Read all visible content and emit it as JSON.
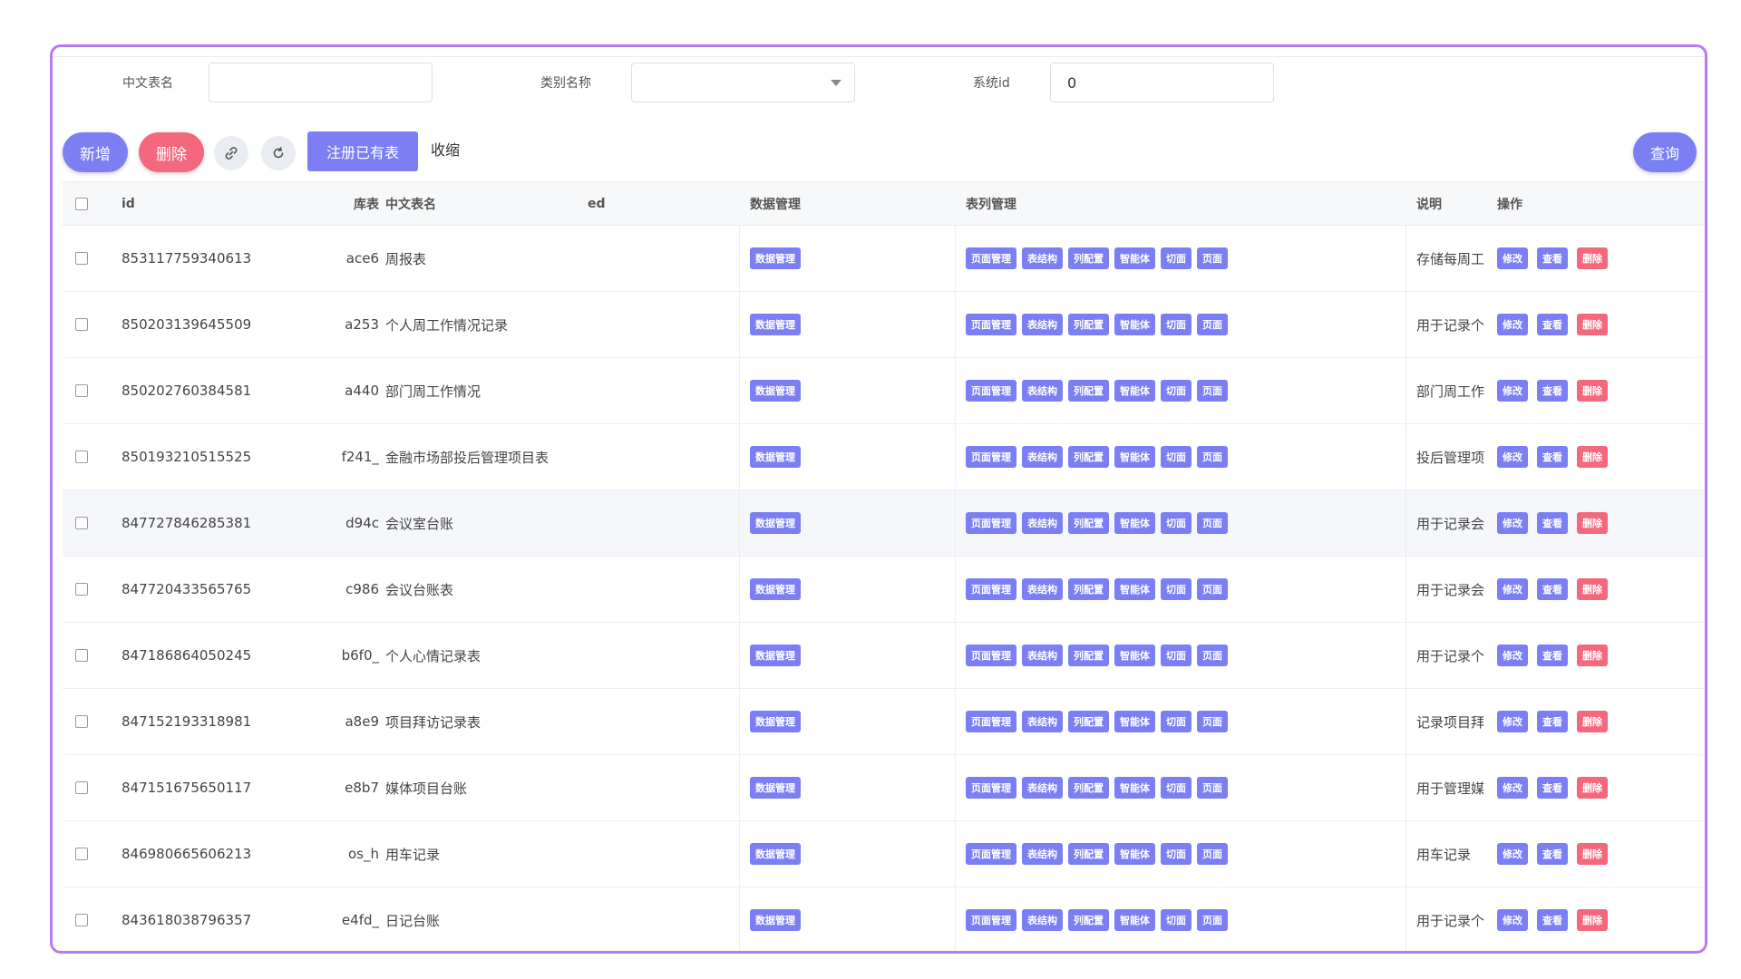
{
  "search": {
    "table_name_label": "中文表名",
    "table_name_value": "",
    "category_label": "类别名称",
    "category_value": "",
    "system_id_label": "系统id",
    "system_id_value": "0"
  },
  "toolbar": {
    "add_label": "新增",
    "delete_label": "删除",
    "link_icon": "link-icon",
    "refresh_icon": "refresh-icon",
    "register_label": "注册已有表",
    "collapse_label": "收缩",
    "query_label": "查询"
  },
  "table": {
    "headers": {
      "id": "id",
      "db_table": "库表",
      "cn_name": "中文表名",
      "extra": "ed",
      "data_mgmt": "数据管理",
      "col_mgmt": "表列管理",
      "desc": "说明",
      "ops": "操作"
    },
    "data_btn": "数据管理",
    "col_btns": [
      "页面管理",
      "表结构",
      "列配置",
      "智能体",
      "切面",
      "页面"
    ],
    "op_btns": [
      "修改",
      "查看",
      "删除"
    ],
    "rows": [
      {
        "id": "853117759340613",
        "db": "ace6",
        "name": "周报表",
        "desc": "存储每周工"
      },
      {
        "id": "850203139645509",
        "db": "a253",
        "name": "个人周工作情况记录",
        "desc": "用于记录个"
      },
      {
        "id": "850202760384581",
        "db": "a440",
        "name": "部门周工作情况",
        "desc": "部门周工作"
      },
      {
        "id": "850193210515525",
        "db": "f241_",
        "name": "金融市场部投后管理项目表",
        "desc": "投后管理项"
      },
      {
        "id": "847727846285381",
        "db": "d94c",
        "name": "会议室台账",
        "desc": "用于记录会"
      },
      {
        "id": "847720433565765",
        "db": "c986",
        "name": "会议台账表",
        "desc": "用于记录会"
      },
      {
        "id": "847186864050245",
        "db": "b6f0_",
        "name": "个人心情记录表",
        "desc": "用于记录个"
      },
      {
        "id": "847152193318981",
        "db": "a8e9",
        "name": "项目拜访记录表",
        "desc": "记录项目拜"
      },
      {
        "id": "847151675650117",
        "db": "e8b7",
        "name": "媒体项目台账",
        "desc": "用于管理媒"
      },
      {
        "id": "846980665606213",
        "db": "os_h",
        "name": "用车记录",
        "desc": "用车记录"
      },
      {
        "id": "843618038796357",
        "db": "e4fd_",
        "name": "日记台账",
        "desc": "用于记录个"
      }
    ]
  },
  "colors": {
    "primary": "#7b7ff3",
    "danger": "#f4687e",
    "frame_border": "#b47cf0"
  }
}
